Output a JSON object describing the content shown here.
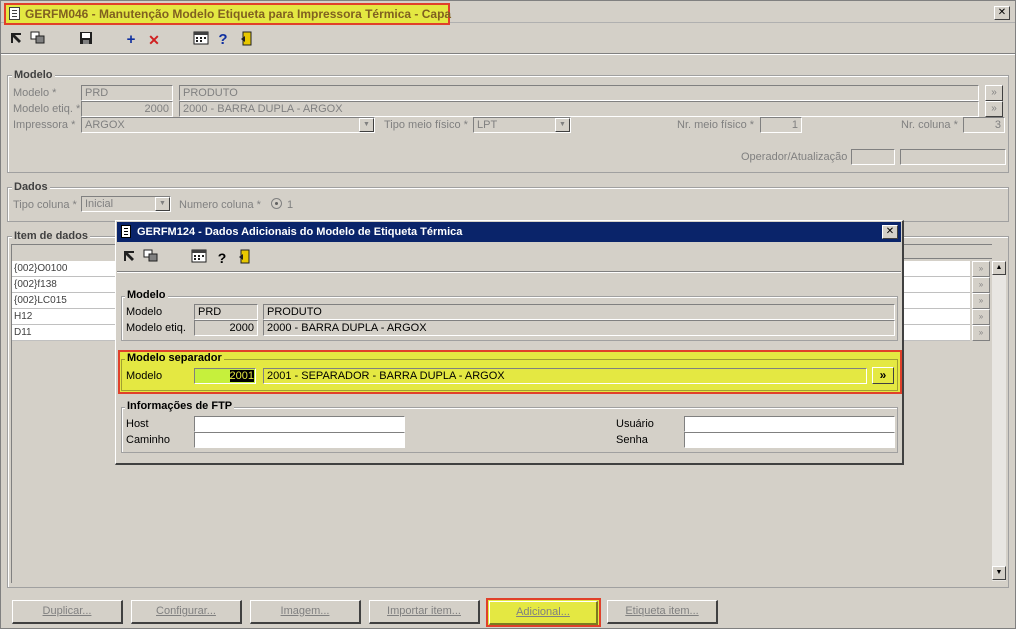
{
  "main_window": {
    "title": "GERFM046 - Manutenção Modelo Etiqueta para Impressora Térmica - Capa",
    "close_glyph": "✕"
  },
  "toolbar_icons": [
    "cursor-arrow-icon",
    "copy-windows-icon",
    "save-disk-icon",
    "add-plus-icon",
    "delete-x-icon",
    "calculator-icon",
    "help-question-icon",
    "exit-door-icon"
  ],
  "modelo_group": {
    "title": "Modelo",
    "modelo_label": "Modelo *",
    "modelo_code": "PRD",
    "modelo_desc": "PRODUTO",
    "modelo_etiq_label": "Modelo etiq. *",
    "modelo_etiq_code": "2000",
    "modelo_etiq_desc": "2000 - BARRA DUPLA - ARGOX",
    "impressora_label": "Impressora *",
    "impressora_value": "ARGOX",
    "tipo_meio_label": "Tipo meio físico *",
    "tipo_meio_value": "LPT",
    "nr_meio_label": "Nr. meio físico *",
    "nr_meio_value": "1",
    "nr_coluna_label": "Nr. coluna *",
    "nr_coluna_value": "3",
    "operador_label": "Operador/Atualização"
  },
  "dados_group": {
    "title": "Dados",
    "tipo_coluna_label": "Tipo coluna *",
    "tipo_coluna_value": "Inicial",
    "numero_coluna_label": "Numero coluna *",
    "numero_coluna_value": "1"
  },
  "item_group": {
    "title": "Item de dados",
    "rows": [
      "{002}O0100",
      "{002}f138",
      "{002}LC015",
      "H12",
      "D11"
    ]
  },
  "bottom_buttons": [
    "Duplicar...",
    "Configurar...",
    "Imagem...",
    "Importar item...",
    "Adicional...",
    "Etiqueta item..."
  ],
  "dialog": {
    "title": "GERFM124 - Dados Adicionais do Modelo de Etiqueta Térmica",
    "close_glyph": "✕",
    "modelo_group": {
      "title": "Modelo",
      "modelo_label": "Modelo",
      "modelo_code": "PRD",
      "modelo_desc": "PRODUTO",
      "modelo_etiq_label": "Modelo etiq.",
      "modelo_etiq_code": "2000",
      "modelo_etiq_desc": "2000 - BARRA DUPLA - ARGOX"
    },
    "separador_group": {
      "title": "Modelo separador",
      "modelo_label": "Modelo",
      "modelo_code": "2001",
      "modelo_desc": "2001 - SEPARADOR - BARRA DUPLA - ARGOX",
      "lookup_glyph": "»"
    },
    "ftp_group": {
      "title": "Informações de FTP",
      "host_label": "Host",
      "caminho_label": "Caminho",
      "usuario_label": "Usuário",
      "senha_label": "Senha",
      "host_value": "",
      "caminho_value": "",
      "usuario_value": "",
      "senha_value": ""
    }
  },
  "colors": {
    "window_bg": "#d4d0c8",
    "highlight_yellow": "#e4e842",
    "highlight_border": "#e0402a",
    "dialog_title_bg": "#0a246a",
    "field_green": "#c6f03c"
  }
}
